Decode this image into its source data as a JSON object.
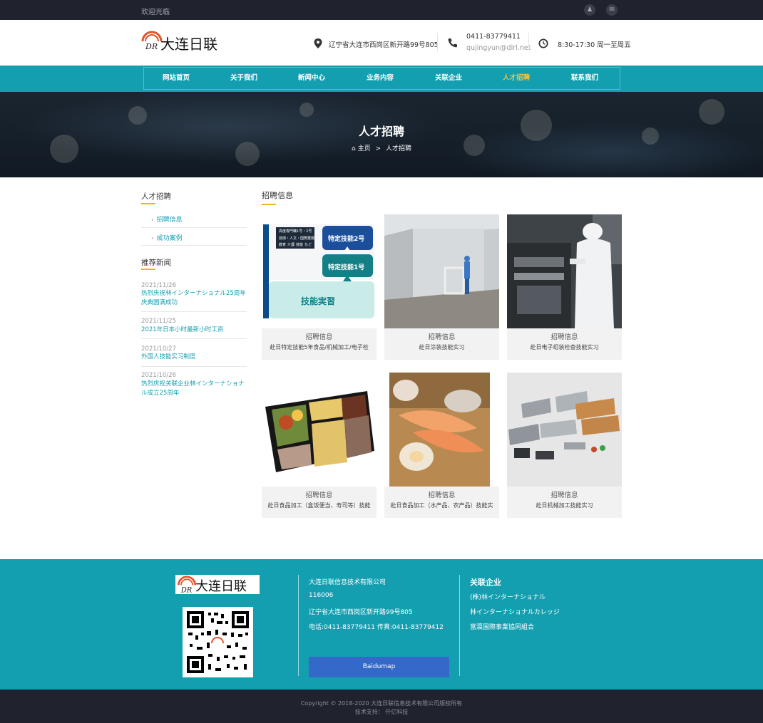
{
  "topbar": {
    "welcome": "欢迎光临",
    "icons": [
      "qq-icon",
      "wechat-icon"
    ]
  },
  "header": {
    "logo_text": "大连日联",
    "address": "辽宁省大连市西岗区新开路99号805",
    "phone": "0411-83779411",
    "email": "qujingyun@dlrl.net",
    "hours": "8:30-17:30 周一至周五"
  },
  "nav": {
    "items": [
      "网站首页",
      "关于我们",
      "新闻中心",
      "业务内容",
      "关联企业",
      "人才招聘",
      "联系我们"
    ],
    "active": "人才招聘"
  },
  "banner": {
    "title": "人才招聘",
    "crumb_home": "主页",
    "crumb_sep": ">",
    "crumb_current": "人才招聘"
  },
  "sidebar": {
    "section_title": "人才招聘",
    "links": [
      "招聘信息",
      "成功案例"
    ],
    "news_title": "推荐新闻",
    "news": [
      {
        "date": "2021/11/26",
        "title": "热烈庆祝林インターナショナル25周年庆典圆满成功"
      },
      {
        "date": "2021/11/25",
        "title": "2021年日本小时最新小时工资"
      },
      {
        "date": "2021/10/27",
        "title": "外国人技能实习制度"
      },
      {
        "date": "2021/10/26",
        "title": "热烈庆祝关联企业林インターナショナル成立25周年"
      }
    ]
  },
  "main": {
    "title": "招聘信息",
    "cards": [
      {
        "title": "招聘信息",
        "desc": "赴日特定技能5年食品/机械加工/电子检"
      },
      {
        "title": "招聘信息",
        "desc": "赴日涂装技能实习"
      },
      {
        "title": "招聘信息",
        "desc": "赴日电子组装检查技能实习"
      },
      {
        "title": "招聘信息",
        "desc": "赴日食品加工（盒饭便当、寿司等）技能"
      },
      {
        "title": "招聘信息",
        "desc": "赴日食品加工（水产品、农产品）技能实"
      },
      {
        "title": "招聘信息",
        "desc": "赴日机械加工技能实习"
      }
    ],
    "card1_image_text": {
      "top_box": "高度専門職1号・2号",
      "top_row": "技術・人文・国際業務",
      "tags": [
        "教育",
        "介護",
        "技能",
        "など"
      ],
      "box2": "特定技能2号",
      "box1": "特定技能1号",
      "bottom": "技能実習"
    }
  },
  "footer": {
    "logo_text": "大连日联",
    "company": "大连日联信息技术有限公司",
    "postcode": "116006",
    "address": "辽宁省大连市西岗区新开路99号805",
    "contact": "电话:0411-83779411 传真:0411-83779412",
    "map_button": "Baidumap",
    "related_title": "关联企业",
    "related": [
      "(株)林インターナショナル",
      "林インターナショナルカレッジ",
      "富瀛国際事業協同組合"
    ]
  },
  "bottom": {
    "copyright": "Copyright © 2018-2020 大连日联信息技术有限公司版权所有",
    "support": "技术支持： 仟亿科技"
  }
}
